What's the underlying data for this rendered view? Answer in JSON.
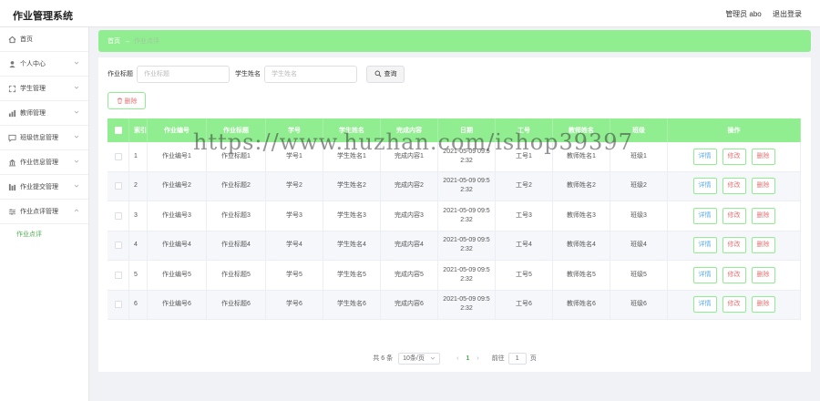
{
  "app": {
    "title": "作业管理系统"
  },
  "topbar": {
    "role_user": "管理员 abo",
    "logout": "退出登录"
  },
  "sidebar": {
    "items": [
      {
        "label": "首页",
        "icon": "home-icon"
      },
      {
        "label": "个人中心",
        "icon": "user-icon"
      },
      {
        "label": "学生管理",
        "icon": "student-icon"
      },
      {
        "label": "教师管理",
        "icon": "chart-icon"
      },
      {
        "label": "班级信息管理",
        "icon": "chat-icon"
      },
      {
        "label": "作业信息管理",
        "icon": "bank-icon"
      },
      {
        "label": "作业提交管理",
        "icon": "bars-icon"
      },
      {
        "label": "作业点评管理",
        "icon": "sliders-icon"
      }
    ],
    "active_sub": "作业点评"
  },
  "breadcrumb": {
    "home": "首页",
    "sep": "→",
    "current": "作业点评"
  },
  "search": {
    "title_label": "作业标题",
    "title_placeholder": "作业标题",
    "student_label": "学生姓名",
    "student_placeholder": "学生姓名",
    "button": "查询"
  },
  "toolbar": {
    "delete_label": "删除"
  },
  "table": {
    "headers": [
      "索引",
      "作业编号",
      "作业标题",
      "学号",
      "学生姓名",
      "完成内容",
      "日期",
      "工号",
      "教师姓名",
      "班级",
      "操作"
    ],
    "rows": [
      {
        "idx": "1",
        "no": "作业编号1",
        "title": "作业标题1",
        "sid": "学号1",
        "sname": "学生姓名1",
        "content": "完成内容1",
        "date1": "2021-05-09 09:5",
        "date2": "2:32",
        "tid": "工号1",
        "tname": "教师姓名1",
        "cls": "班级1"
      },
      {
        "idx": "2",
        "no": "作业编号2",
        "title": "作业标题2",
        "sid": "学号2",
        "sname": "学生姓名2",
        "content": "完成内容2",
        "date1": "2021-05-09 09:5",
        "date2": "2:32",
        "tid": "工号2",
        "tname": "教师姓名2",
        "cls": "班级2"
      },
      {
        "idx": "3",
        "no": "作业编号3",
        "title": "作业标题3",
        "sid": "学号3",
        "sname": "学生姓名3",
        "content": "完成内容3",
        "date1": "2021-05-09 09:5",
        "date2": "2:32",
        "tid": "工号3",
        "tname": "教师姓名3",
        "cls": "班级3"
      },
      {
        "idx": "4",
        "no": "作业编号4",
        "title": "作业标题4",
        "sid": "学号4",
        "sname": "学生姓名4",
        "content": "完成内容4",
        "date1": "2021-05-09 09:5",
        "date2": "2:32",
        "tid": "工号4",
        "tname": "教师姓名4",
        "cls": "班级4"
      },
      {
        "idx": "5",
        "no": "作业编号5",
        "title": "作业标题5",
        "sid": "学号5",
        "sname": "学生姓名5",
        "content": "完成内容5",
        "date1": "2021-05-09 09:5",
        "date2": "2:32",
        "tid": "工号5",
        "tname": "教师姓名5",
        "cls": "班级5"
      },
      {
        "idx": "6",
        "no": "作业编号6",
        "title": "作业标题6",
        "sid": "学号6",
        "sname": "学生姓名6",
        "content": "完成内容6",
        "date1": "2021-05-09 09:5",
        "date2": "2:32",
        "tid": "工号6",
        "tname": "教师姓名6",
        "cls": "班级6"
      }
    ],
    "actions": {
      "detail": "详情",
      "edit": "修改",
      "delete": "删除"
    }
  },
  "pager": {
    "total": "共 6 条",
    "size": "10条/页",
    "prev": "‹",
    "page": "1",
    "next": "›",
    "goto": "前往",
    "goto_value": "1",
    "page_suffix": "页"
  },
  "watermark": "https://www.huzhan.com/ishop39397",
  "colors": {
    "accent": "#90ee90",
    "active_text": "#4caf50",
    "danger_text": "#e57373",
    "info_text": "#5dade2"
  }
}
